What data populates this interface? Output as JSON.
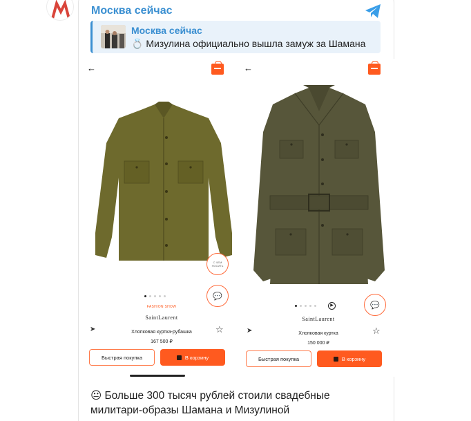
{
  "channel": {
    "name": "Москва сейчас"
  },
  "quote": {
    "title": "Москва сейчас",
    "text": "💍 Мизулина официально вышла замуж за Шамана"
  },
  "products": [
    {
      "fashion_tag": "FASHION SHOW",
      "brand": "SaintLaurent",
      "name": "Хлопковая куртка-рубашка",
      "price": "167 500 ₽",
      "quick_buy": "Быстрая покупка",
      "to_cart": "В корзину",
      "how_to_wear": "С ЧЕМ НОСИТЬ",
      "garment_color": "#6e6a2d",
      "images_count": 5,
      "active_image": 1
    },
    {
      "brand": "SaintLaurent",
      "name": "Хлопковая куртка",
      "price": "150 000 ₽",
      "quick_buy": "Быстрая покупка",
      "to_cart": "В корзину",
      "garment_color": "#57563a",
      "images_count": 5,
      "active_image": 1
    }
  ],
  "caption": "😐 Больше 300 тысяч рублей стоили свадебные милитари-образы Шамана и Мизулиной",
  "colors": {
    "accent": "#ff5a1f",
    "link": "#3a8fd1",
    "quote_bg": "#e9f2fa"
  }
}
